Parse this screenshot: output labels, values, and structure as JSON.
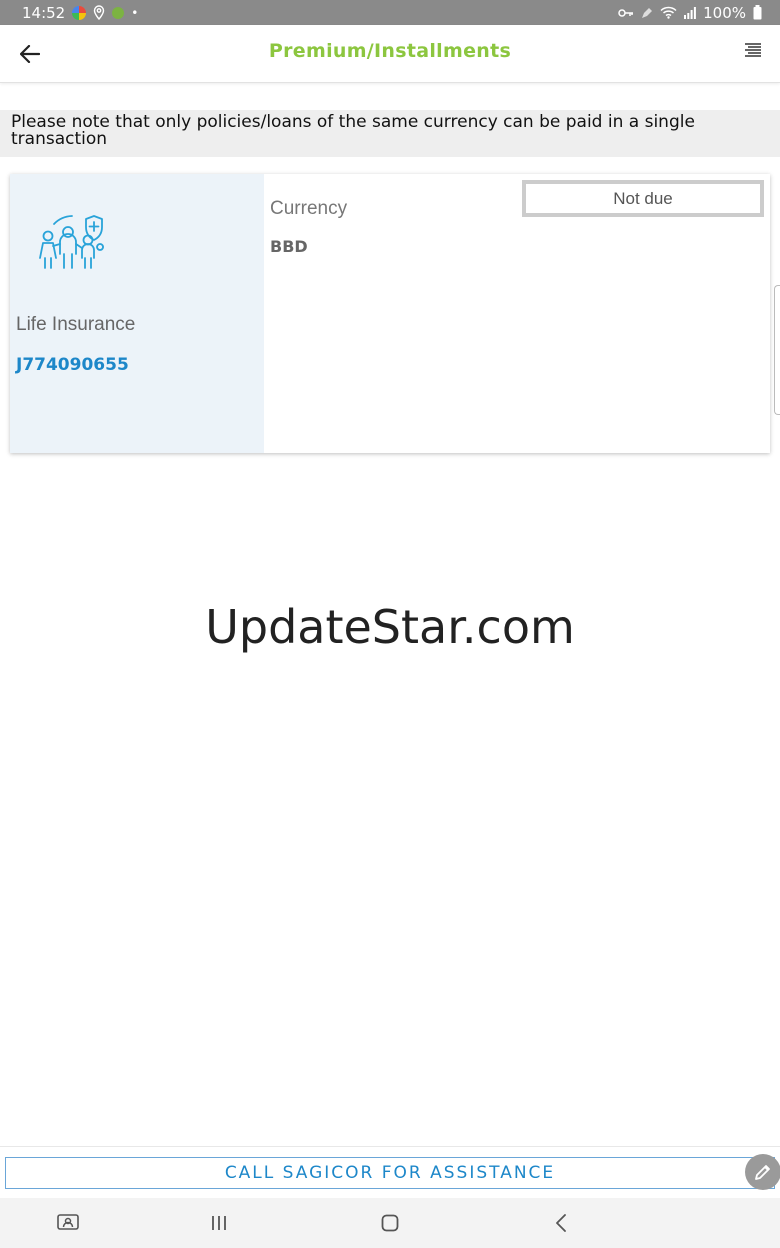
{
  "statusbar": {
    "time": "14:52",
    "battery": "100%"
  },
  "appbar": {
    "title": "Premium/Installments"
  },
  "notice": {
    "text": "Please note that only policies/loans of the same currency can be paid in a single transaction"
  },
  "policy_card": {
    "product_name": "Life Insurance",
    "policy_number": "J774090655",
    "currency_label": "Currency",
    "currency_value": "BBD",
    "status": "Not due"
  },
  "watermark": {
    "text": "UpdateStar.com"
  },
  "footer": {
    "assist_label": "CALL SAGICOR FOR ASSISTANCE"
  },
  "colors": {
    "brand_green": "#8cc63f",
    "brand_blue": "#1d87c9",
    "card_left_bg": "#ecf3f9"
  }
}
